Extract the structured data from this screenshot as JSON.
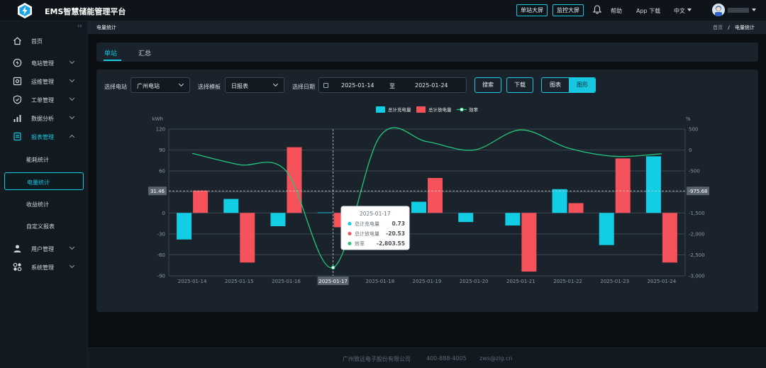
{
  "header": {
    "title": "EMS智慧储能管理平台",
    "btn_station_screen": "单站大屏",
    "btn_monitor_screen": "监控大屏",
    "help": "帮助",
    "app_download": "App 下载",
    "language": "中文"
  },
  "sidebar": {
    "items": [
      {
        "label": "首页"
      },
      {
        "label": "电站管理"
      },
      {
        "label": "运维管理"
      },
      {
        "label": "工单管理"
      },
      {
        "label": "数据分析"
      },
      {
        "label": "报表管理"
      },
      {
        "label": "用户管理"
      },
      {
        "label": "系统管理"
      }
    ],
    "sub_items": [
      {
        "label": "能耗统计"
      },
      {
        "label": "电量统计"
      },
      {
        "label": "收益统计"
      },
      {
        "label": "自定义报表"
      }
    ]
  },
  "breadcrumb": {
    "page_title": "电量统计",
    "home": "首页",
    "sep": "/",
    "current": "电量统计"
  },
  "tabs": [
    {
      "label": "单站"
    },
    {
      "label": "汇总"
    }
  ],
  "filters": {
    "station_label": "选择电站",
    "station_value": "广州电站",
    "template_label": "选择模板",
    "template_value": "日报表",
    "date_label": "选择日期",
    "date_start": "2025-01-14",
    "date_to": "至",
    "date_end": "2025-01-24",
    "search": "搜索",
    "download": "下载",
    "view_table": "图表",
    "view_chart": "图形"
  },
  "chart_data": {
    "type": "bar",
    "categories": [
      "2025-01-14",
      "2025-01-15",
      "2025-01-16",
      "2025-01-17",
      "2025-01-18",
      "2025-01-19",
      "2025-01-20",
      "2025-01-21",
      "2025-01-22",
      "2025-01-23",
      "2025-01-24"
    ],
    "ylabel_left": "kWh",
    "ylabel_right": "%",
    "ylim_left": [
      -90,
      120
    ],
    "ylim_right": [
      -3000,
      500
    ],
    "yticks_left": [
      "120",
      "90",
      "60",
      "30",
      "0",
      "-30",
      "-60",
      "-90"
    ],
    "yticks_right": [
      "500",
      "0",
      "-500",
      "-1,000",
      "-1,500",
      "-2,000",
      "-2,500",
      "-3,000"
    ],
    "series": [
      {
        "name": "总计充电量",
        "type": "bar",
        "color": "#12cde4",
        "values": [
          -38,
          20,
          -19,
          0.73,
          0,
          16,
          -13,
          -18,
          34,
          -46,
          81
        ]
      },
      {
        "name": "总计放电量",
        "type": "bar",
        "color": "#f5525c",
        "values": [
          32,
          -71,
          94,
          -20.53,
          0,
          50,
          0,
          -84,
          14,
          78,
          -71
        ]
      },
      {
        "name": "效率",
        "type": "line",
        "color": "#22c77a",
        "values": [
          -80,
          -350,
          -500,
          -2803.55,
          330,
          200,
          0,
          480,
          50,
          -150,
          -90
        ]
      }
    ],
    "crosshair": {
      "category": "2025-01-17",
      "left_value": "31.46",
      "right_value": "-975.68"
    },
    "tooltip": {
      "title": "2025-01-17",
      "rows": [
        {
          "name": "总计充电量",
          "value": "0.73",
          "color": "#12cde4"
        },
        {
          "name": "总计放电量",
          "value": "-20.53",
          "color": "#f5525c"
        },
        {
          "name": "效率",
          "value": "-2,803.55",
          "color": "#22c77a"
        }
      ]
    },
    "legend_placement": "top-center",
    "grid": true
  },
  "footer": {
    "company": "广州致远电子股份有限公司",
    "phone": "400-888-4005",
    "email": "zws@zlg.cn"
  }
}
